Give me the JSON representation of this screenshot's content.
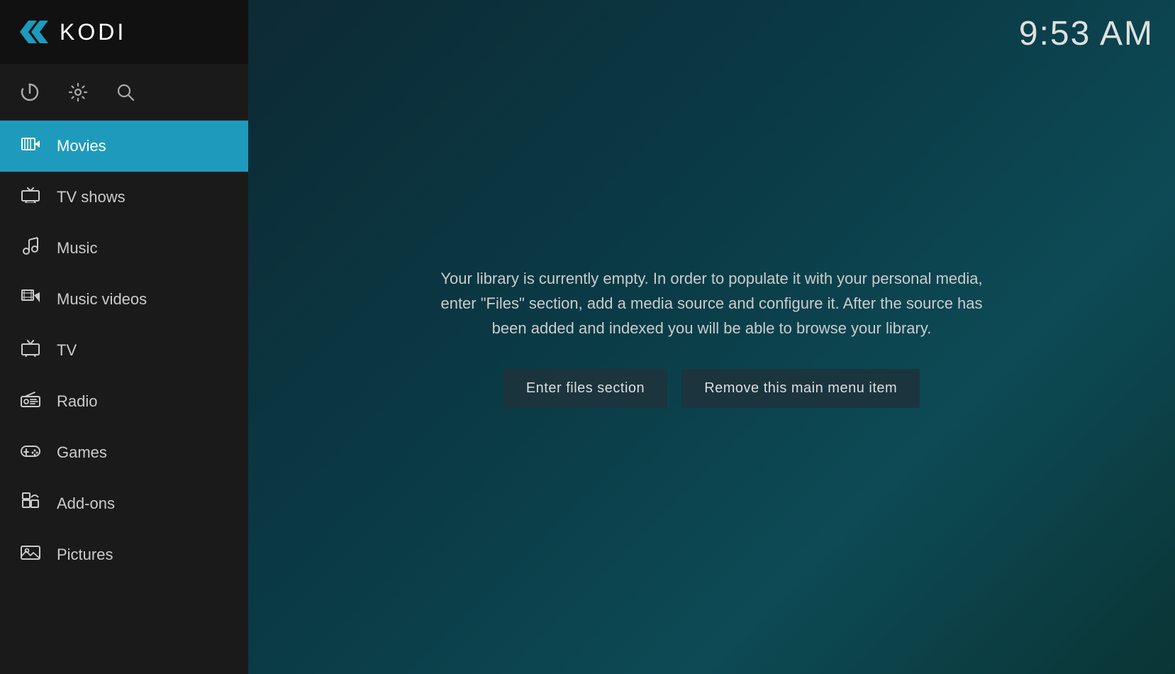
{
  "app": {
    "name": "KODI",
    "time": "9:53 AM"
  },
  "toolbar": {
    "power_label": "Power",
    "settings_label": "Settings",
    "search_label": "Search"
  },
  "nav": {
    "items": [
      {
        "id": "movies",
        "label": "Movies",
        "icon": "movies",
        "active": true
      },
      {
        "id": "tvshows",
        "label": "TV shows",
        "icon": "tv",
        "active": false
      },
      {
        "id": "music",
        "label": "Music",
        "icon": "music",
        "active": false
      },
      {
        "id": "musicvideos",
        "label": "Music videos",
        "icon": "musicvideos",
        "active": false
      },
      {
        "id": "tv",
        "label": "TV",
        "icon": "antenna",
        "active": false
      },
      {
        "id": "radio",
        "label": "Radio",
        "icon": "radio",
        "active": false
      },
      {
        "id": "games",
        "label": "Games",
        "icon": "games",
        "active": false
      },
      {
        "id": "addons",
        "label": "Add-ons",
        "icon": "addons",
        "active": false
      },
      {
        "id": "pictures",
        "label": "Pictures",
        "icon": "pictures",
        "active": false
      }
    ]
  },
  "main": {
    "empty_library_message": "Your library is currently empty. In order to populate it with your personal media, enter \"Files\" section, add a media source and configure it. After the source has been added and indexed you will be able to browse your library.",
    "btn_enter_files": "Enter files section",
    "btn_remove_menu": "Remove this main menu item"
  }
}
